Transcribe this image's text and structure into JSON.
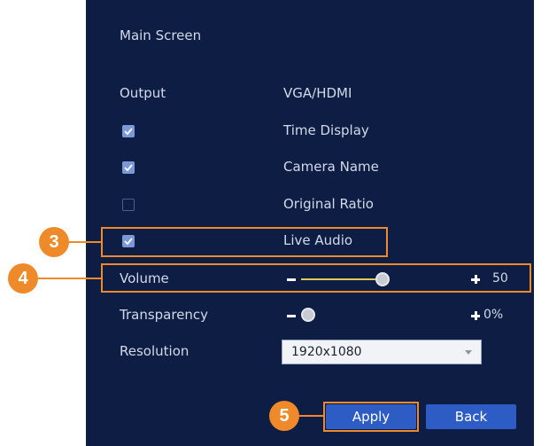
{
  "header": {
    "title": "Main Screen"
  },
  "output": {
    "label": "Output",
    "value": "VGA/HDMI"
  },
  "options": [
    {
      "label": "Time Display",
      "checked": true
    },
    {
      "label": "Camera Name",
      "checked": true
    },
    {
      "label": "Original Ratio",
      "checked": false
    },
    {
      "label": "Live Audio",
      "checked": true
    }
  ],
  "volume": {
    "label": "Volume",
    "value_text": "50",
    "level_percent": 50
  },
  "transparency": {
    "label": "Transparency",
    "value_text": "0%",
    "level_percent": 0
  },
  "resolution": {
    "label": "Resolution",
    "selected": "1920x1080"
  },
  "buttons": {
    "apply": "Apply",
    "back": "Back"
  },
  "annotations": {
    "step3": "3",
    "step4": "4",
    "step5": "5"
  },
  "colors": {
    "panel_bg": "#0d1d44",
    "annotation": "#ef8a2b",
    "button": "#2d5cc4",
    "checkbox_checked": "#7c98d6",
    "slider_track": "#e3c95b"
  }
}
